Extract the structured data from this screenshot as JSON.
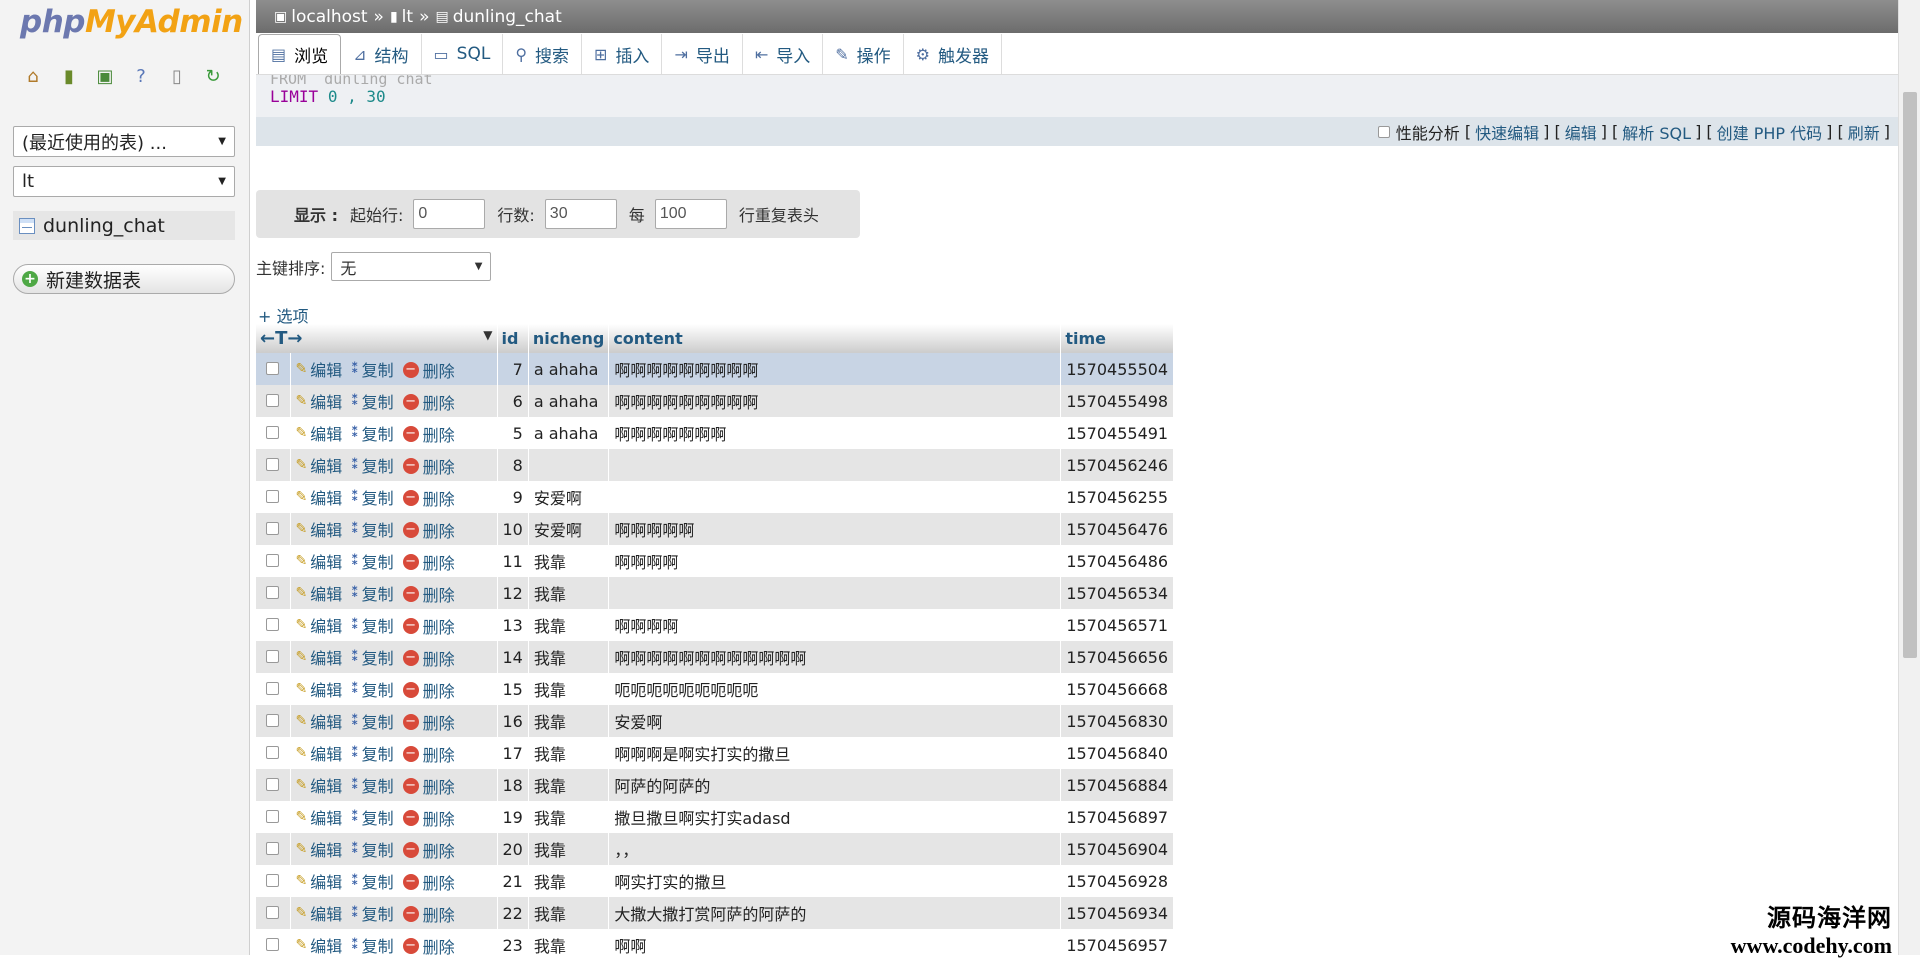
{
  "nav": {
    "logo_php": "php",
    "logo_myadmin": "MyAdmin",
    "icons": [
      "home-icon",
      "exit-icon",
      "query-icon",
      "help-icon",
      "docs-icon",
      "reload-icon"
    ],
    "recent_select": "(最近使用的表) ...",
    "db_select": "lt",
    "table_name": "dunling_chat",
    "new_table_label": "新建数据表"
  },
  "breadcrumb": {
    "server": "localhost",
    "database": "lt",
    "table": "dunling_chat"
  },
  "tabs": [
    {
      "label": "浏览",
      "icon": "browse-icon"
    },
    {
      "label": "结构",
      "icon": "structure-icon"
    },
    {
      "label": "SQL",
      "icon": "sql-icon"
    },
    {
      "label": "搜索",
      "icon": "search-icon"
    },
    {
      "label": "插入",
      "icon": "insert-icon"
    },
    {
      "label": "导出",
      "icon": "export-icon"
    },
    {
      "label": "导入",
      "icon": "import-icon"
    },
    {
      "label": "操作",
      "icon": "wrench-icon"
    },
    {
      "label": "触发器",
      "icon": "trigger-icon"
    }
  ],
  "sql": {
    "ghost": "FROM `dunling_chat`",
    "limit_kw": "LIMIT",
    "limit_vals": "0 , 30"
  },
  "sql_actions": {
    "profiling": "性能分析",
    "links": [
      "快速编辑",
      "编辑",
      "解析 SQL",
      "创建 PHP 代码",
      "刷新"
    ]
  },
  "display": {
    "label": "显示 :",
    "start_label": "起始行:",
    "start_value": "0",
    "rows_label": "行数:",
    "rows_value": "30",
    "every_label": "每",
    "every_value": "100",
    "repeat_label": "行重复表头"
  },
  "sort": {
    "label": "主键排序:",
    "value": "无"
  },
  "options_link": "+ 选项",
  "table": {
    "arrows": "←T→",
    "columns": [
      "id",
      "nicheng",
      "content",
      "time"
    ],
    "action_edit": "编辑",
    "action_copy": "复制",
    "action_delete": "删除",
    "rows": [
      {
        "id": "7",
        "nicheng": "a ahaha",
        "content": "啊啊啊啊啊啊啊啊啊",
        "time": "1570455504"
      },
      {
        "id": "6",
        "nicheng": "a ahaha",
        "content": "啊啊啊啊啊啊啊啊啊",
        "time": "1570455498"
      },
      {
        "id": "5",
        "nicheng": "a ahaha",
        "content": "啊啊啊啊啊啊啊",
        "time": "1570455491"
      },
      {
        "id": "8",
        "nicheng": "",
        "content": "",
        "time": "1570456246"
      },
      {
        "id": "9",
        "nicheng": "安爱啊",
        "content": "",
        "time": "1570456255"
      },
      {
        "id": "10",
        "nicheng": "安爱啊",
        "content": "啊啊啊啊啊",
        "time": "1570456476"
      },
      {
        "id": "11",
        "nicheng": "我靠",
        "content": "啊啊啊啊",
        "time": "1570456486"
      },
      {
        "id": "12",
        "nicheng": "我靠",
        "content": "",
        "time": "1570456534"
      },
      {
        "id": "13",
        "nicheng": "我靠",
        "content": "啊啊啊啊",
        "time": "1570456571"
      },
      {
        "id": "14",
        "nicheng": "我靠",
        "content": "啊啊啊啊啊啊啊啊啊啊啊啊",
        "time": "1570456656"
      },
      {
        "id": "15",
        "nicheng": "我靠",
        "content": "呃呃呃呃呃呃呃呃呃",
        "time": "1570456668"
      },
      {
        "id": "16",
        "nicheng": "我靠",
        "content": "安爱啊",
        "time": "1570456830"
      },
      {
        "id": "17",
        "nicheng": "我靠",
        "content": "啊啊啊是啊实打实的撒旦",
        "time": "1570456840"
      },
      {
        "id": "18",
        "nicheng": "我靠",
        "content": "阿萨的阿萨的",
        "time": "1570456884"
      },
      {
        "id": "19",
        "nicheng": "我靠",
        "content": "撒旦撒旦啊实打实adasd",
        "time": "1570456897"
      },
      {
        "id": "20",
        "nicheng": "我靠",
        "content": "，，",
        "time": "1570456904"
      },
      {
        "id": "21",
        "nicheng": "我靠",
        "content": "啊实打实的撒旦",
        "time": "1570456928"
      },
      {
        "id": "22",
        "nicheng": "我靠",
        "content": "大撒大撒打赏阿萨的阿萨的",
        "time": "1570456934"
      },
      {
        "id": "23",
        "nicheng": "我靠",
        "content": "啊啊",
        "time": "1570456957"
      }
    ]
  },
  "watermark": {
    "line1": "源码海洋网",
    "line2": "www.codehy.com"
  }
}
